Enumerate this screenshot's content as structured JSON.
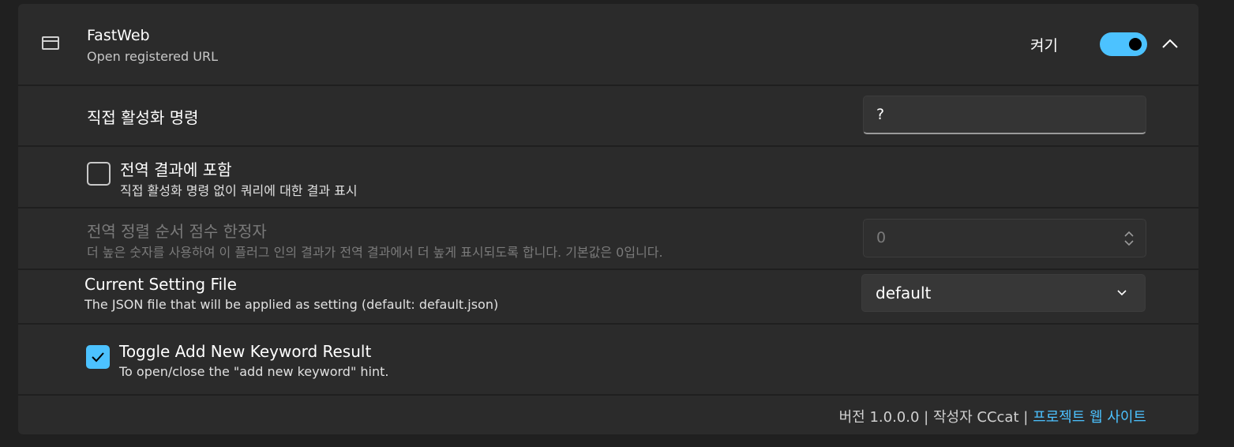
{
  "plugin": {
    "name": "FastWeb",
    "description": "Open registered URL",
    "toggle_label": "켜기",
    "enabled": true
  },
  "settings": {
    "action_keyword": {
      "label": "직접 활성화 명령",
      "value": "?"
    },
    "include_global": {
      "label": "전역 결과에 포함",
      "description": "직접 활성화 명령 없이 쿼리에 대한 결과 표시",
      "checked": false
    },
    "global_score": {
      "label": "전역 정렬 순서 점수 한정자",
      "description": "더 높은 숫자를 사용하여 이 플러그 인의 결과가 전역 결과에서 더 높게 표시되도록 합니다. 기본값은 0입니다.",
      "value": "0",
      "disabled": true
    },
    "setting_file": {
      "label": "Current Setting File",
      "description": "The JSON file that will be applied as setting (default: default.json)",
      "selected": "default"
    },
    "toggle_add_keyword": {
      "label": "Toggle Add New Keyword Result",
      "description": "To open/close the \"add new keyword\" hint.",
      "checked": true
    }
  },
  "footer": {
    "version_text": "버전 1.0.0.0",
    "separator": "|",
    "author_text": "작성자 CCcat",
    "website_link": "프로젝트 웹 사이트"
  },
  "colors": {
    "accent": "#4cc2ff",
    "card_bg": "#2b2b2b",
    "page_bg": "#202020"
  }
}
